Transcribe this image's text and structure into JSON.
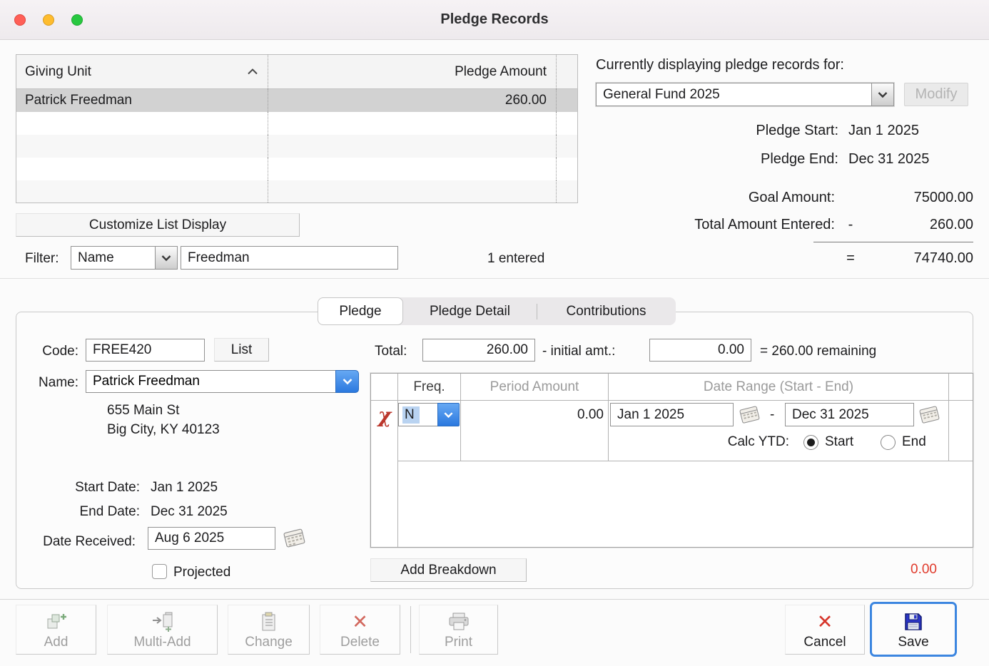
{
  "window": {
    "title": "Pledge Records"
  },
  "giving_list": {
    "header": {
      "unit": "Giving Unit",
      "amount": "Pledge Amount"
    },
    "rows": [
      {
        "unit": "Patrick Freedman",
        "amount": "260.00"
      }
    ],
    "customize_button": "Customize List Display",
    "filter_label": "Filter:",
    "filter_field": "Name",
    "filter_value": "Freedman",
    "entered": "1 entered"
  },
  "fund": {
    "heading": "Currently displaying pledge records for:",
    "selected": "General Fund 2025",
    "modify": "Modify",
    "start_label": "Pledge Start:",
    "start_value": "Jan 1 2025",
    "end_label": "Pledge End:",
    "end_value": "Dec 31 2025",
    "goal_label": "Goal Amount:",
    "goal_value": "75000.00",
    "entered_label": "Total Amount Entered:",
    "minus": "-",
    "entered_value": "260.00",
    "equals": "=",
    "remaining_value": "74740.00"
  },
  "tabs": {
    "pledge": "Pledge",
    "detail": "Pledge Detail",
    "contributions": "Contributions"
  },
  "pledge_form": {
    "code_label": "Code:",
    "code_value": "FREE420",
    "list_button": "List",
    "name_label": "Name:",
    "name_value": "Patrick Freedman",
    "address1": "655 Main St",
    "address2": "Big City, KY 40123",
    "start_label": "Start Date:",
    "start_value": "Jan 1 2025",
    "end_label": "End Date:",
    "end_value": "Dec 31 2025",
    "received_label": "Date Received:",
    "received_value": "Aug 6 2025",
    "projected_label": "Projected",
    "total_label": "Total:",
    "total_value": "260.00",
    "initial_label": "- initial amt.:",
    "initial_value": "0.00",
    "remaining_text": "= 260.00 remaining"
  },
  "breakdown": {
    "freq_header": "Freq.",
    "period_header": "Period Amount",
    "range_header": "Date Range (Start - End)",
    "row": {
      "freq": "N",
      "period_amount": "0.00",
      "start_date": "Jan 1 2025",
      "dash": "-",
      "end_date": "Dec 31 2025"
    },
    "calc_label": "Calc YTD:",
    "calc_start": "Start",
    "calc_end": "End",
    "add_button": "Add Breakdown",
    "total": "0.00"
  },
  "toolbar": {
    "add": "Add",
    "multi_add": "Multi-Add",
    "change": "Change",
    "delete": "Delete",
    "print": "Print",
    "cancel": "Cancel",
    "save": "Save"
  },
  "icons": {
    "x": "✕",
    "chi": "χ"
  },
  "colors": {
    "accent_blue": "#2b79df",
    "alert_red": "#e03a2b",
    "selection_blue": "#b9d3f1",
    "focus_ring": "#3c86e0"
  }
}
